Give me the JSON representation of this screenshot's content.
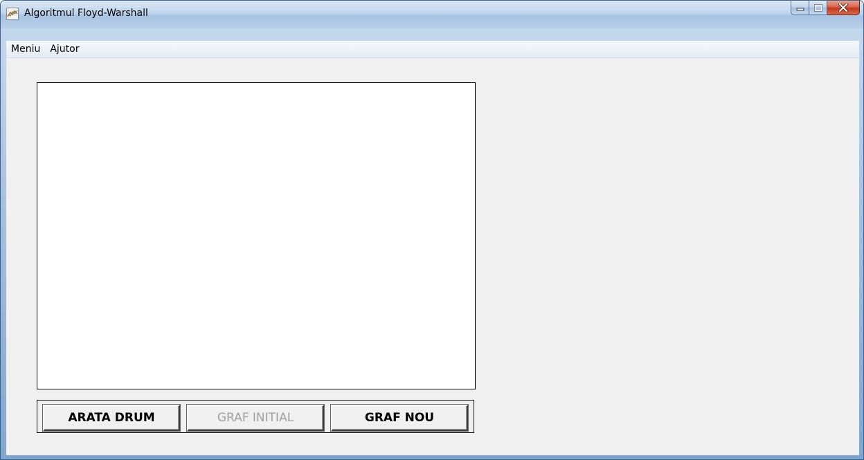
{
  "window": {
    "title": "Algoritmul Floyd-Warshall",
    "minimize_glyph": "−",
    "maximize_glyph": "□",
    "close_glyph": "X"
  },
  "menubar": {
    "items": [
      {
        "label": "Meniu"
      },
      {
        "label": "Ajutor"
      }
    ]
  },
  "buttons": {
    "show_path": {
      "label": "ARATA DRUM",
      "enabled": true
    },
    "initial_graph": {
      "label": "GRAF INITIAL",
      "enabled": false
    },
    "new_graph": {
      "label": "GRAF NOU",
      "enabled": true
    }
  },
  "icons": {
    "app": "chart-line-icon",
    "minimize": "minimize-icon",
    "maximize": "maximize-icon",
    "close": "close-icon"
  },
  "colors": {
    "titlebar": "#c0d5ec",
    "client_bg": "#f0f0f0",
    "canvas_bg": "#ffffff",
    "close_button": "#c3381c",
    "disabled_text": "#a0a0a0"
  }
}
